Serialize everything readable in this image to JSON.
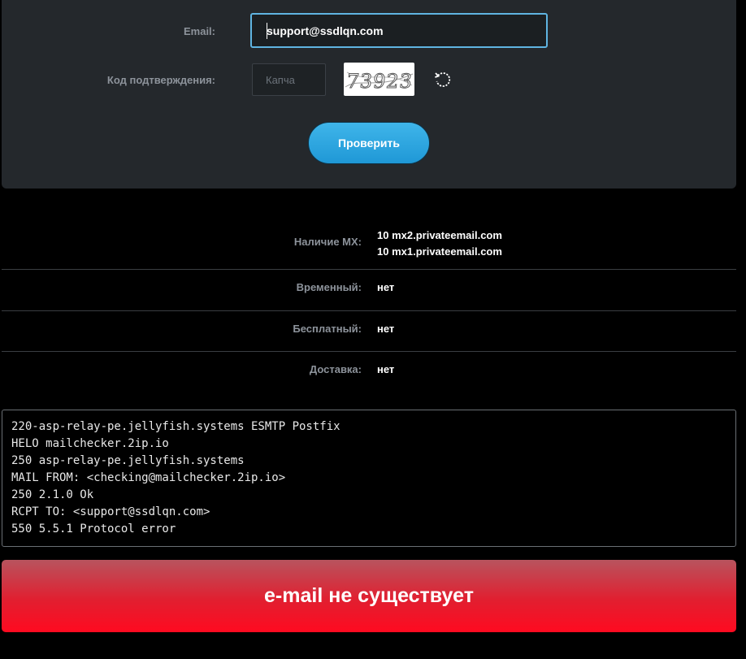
{
  "form": {
    "email_label": "Email:",
    "email_value": "support@ssdlqn.com",
    "captcha_label": "Код подтверждения:",
    "captcha_placeholder": "Капча",
    "captcha_image_text": "73923",
    "check_button_label": "Проверить"
  },
  "results": {
    "mx_label": "Наличие MX:",
    "mx_records": [
      "10 mx2.privateemail.com",
      "10 mx1.privateemail.com"
    ],
    "temporary_label": "Временный:",
    "temporary_value": "нет",
    "free_label": "Бесплатный:",
    "free_value": "нет",
    "delivery_label": "Доставка:",
    "delivery_value": "нет"
  },
  "smtp_log": [
    "220-asp-relay-pe.jellyfish.systems ESMTP Postfix",
    "HELO mailchecker.2ip.io",
    "250 asp-relay-pe.jellyfish.systems",
    "MAIL FROM: <checking@mailchecker.2ip.io>",
    "250 2.1.0 Ok",
    "RCPT TO: <support@ssdlqn.com>",
    "550 5.5.1 Protocol error"
  ],
  "verdict": {
    "text": "e-mail не существует",
    "color": "#ff0a20"
  },
  "colors": {
    "panel_bg": "#24282c",
    "accent": "#3fb5ea",
    "input_border_focus": "#5fb4e1",
    "label": "#8d939b"
  }
}
